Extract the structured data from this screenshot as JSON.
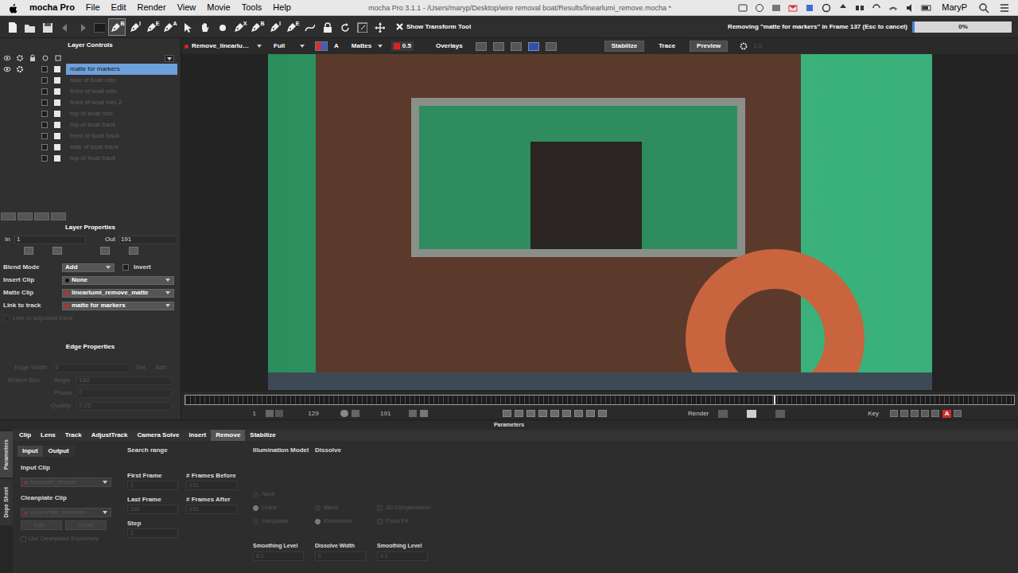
{
  "menubar": {
    "app": "mocha Pro",
    "menus": [
      "File",
      "Edit",
      "Render",
      "View",
      "Movie",
      "Tools",
      "Help"
    ],
    "user": "MaryP"
  },
  "window": {
    "title": "mocha Pro 3.1.1 - /Users/maryp/Desktop/wire removal boat/Results/linearlumi_remove.mocha *"
  },
  "toolbar": {
    "tools": [
      {
        "kind": "new",
        "selected": false
      },
      {
        "kind": "open",
        "selected": false
      },
      {
        "kind": "save",
        "selected": false
      },
      {
        "kind": "back",
        "selected": false
      },
      {
        "kind": "forward",
        "selected": false
      },
      {
        "kind": "box",
        "selected": false
      },
      {
        "kind": "pen",
        "label": "B",
        "selected": true
      },
      {
        "kind": "pen",
        "label": "I",
        "selected": false
      },
      {
        "kind": "pen",
        "label": "E",
        "selected": false
      },
      {
        "kind": "pen",
        "label": "A",
        "selected": false
      },
      {
        "kind": "pointer",
        "selected": false
      },
      {
        "kind": "hand",
        "selected": false
      },
      {
        "kind": "circle",
        "selected": false
      },
      {
        "kind": "pen",
        "label": "X",
        "selected": false
      },
      {
        "kind": "pen",
        "label": "B",
        "selected": false
      },
      {
        "kind": "pen",
        "label": "I",
        "selected": false
      },
      {
        "kind": "pen",
        "label": "E",
        "selected": false
      },
      {
        "kind": "curve",
        "selected": false
      },
      {
        "kind": "lock",
        "selected": false
      },
      {
        "kind": "rotate",
        "selected": false
      },
      {
        "kind": "scale",
        "selected": false
      },
      {
        "kind": "move",
        "selected": false
      }
    ],
    "show_transform": {
      "label": "Show Transform Tool",
      "checked": true
    },
    "status": "Removing \"matte for markers\" in Frame 137 (Esc to cancel)",
    "progress": {
      "reading": "0%",
      "level": 0.0
    }
  },
  "viewerbar": {
    "clip": "Remove_linearlumi_",
    "resolution": "Full",
    "alpha": "A",
    "mattes": "Mattes",
    "opacity": "0.5",
    "overlays": "Overlays",
    "modes": [
      {
        "label": "Stabilize",
        "selected": true
      },
      {
        "label": "Trace",
        "selected": false
      },
      {
        "label": "Preview",
        "selected": true
      }
    ],
    "zoom": "1.0"
  },
  "layer_controls": {
    "title": "Layer Controls",
    "layers": [
      {
        "name": "matte for markers",
        "visible": true,
        "selected": true
      },
      {
        "name": "side of boat roto",
        "visible": false,
        "selected": false
      },
      {
        "name": "front of boat roto",
        "visible": false,
        "selected": false
      },
      {
        "name": "front of boat roto 2",
        "visible": false,
        "selected": false
      },
      {
        "name": "top of boat roto",
        "visible": false,
        "selected": false
      },
      {
        "name": "top of boat track",
        "visible": false,
        "selected": false
      },
      {
        "name": "front of boat track",
        "visible": false,
        "selected": false
      },
      {
        "name": "side of boat track",
        "visible": false,
        "selected": false
      },
      {
        "name": "top of boat track",
        "visible": false,
        "selected": false
      }
    ]
  },
  "layer_properties": {
    "title": "Layer Properties",
    "in_label": "In",
    "in": "1",
    "out_label": "Out",
    "out": "191",
    "blend_mode": {
      "label": "Blend Mode",
      "value": "Add"
    },
    "invert": {
      "label": "Invert",
      "checked": false
    },
    "insert_clip": {
      "label": "Insert Clip",
      "value": "None"
    },
    "matte_clip": {
      "label": "Matte Clip",
      "value": "linearlumi_remove_matte"
    },
    "link_to_track": {
      "label": "Link to track",
      "value": "matte for markers"
    },
    "link_adjusted": {
      "label": "Link to adjusted track",
      "checked": false,
      "disabled": true
    }
  },
  "edge_properties": {
    "title": "Edge Properties",
    "disabled": true,
    "edge_width": {
      "label": "Edge Width",
      "value": "5"
    },
    "set": "Set",
    "add": "Add",
    "motion_blur": "Motion Blur",
    "angle": {
      "label": "Angle",
      "value": "180"
    },
    "phase": {
      "label": "Phase",
      "value": "0"
    },
    "quality": {
      "label": "Quality",
      "value": "0.25"
    }
  },
  "timeline": {
    "playhead": 0.71,
    "start": "1",
    "current": "129",
    "end": "191",
    "render": "Render",
    "key": "Key",
    "auto_key": "A"
  },
  "parameters_label": "Parameters",
  "side_tabs": [
    {
      "label": "Parameters",
      "selected": true
    },
    {
      "label": "Dope Sheet",
      "selected": false
    }
  ],
  "module_tabs": [
    {
      "label": "Clip",
      "selected": false
    },
    {
      "label": "Lens",
      "selected": false
    },
    {
      "label": "Track",
      "selected": false
    },
    {
      "label": "AdjustTrack",
      "selected": false
    },
    {
      "label": "Camera Solve",
      "selected": false
    },
    {
      "label": "Insert",
      "selected": false
    },
    {
      "label": "Remove",
      "selected": true
    },
    {
      "label": "Stabilize",
      "selected": false
    }
  ],
  "remove": {
    "disabled": true,
    "io_tabs": [
      {
        "label": "Input",
        "selected": true
      },
      {
        "label": "Output",
        "selected": false
      }
    ],
    "input_clip": {
      "label": "Input Clip",
      "value": "linearlumi_remove"
    },
    "cleanplate_clip": {
      "label": "Cleanplate Clip",
      "value": "Clean Plate_linearlumi"
    },
    "edit": "Edit...",
    "create": "Create",
    "use_cleanplates": {
      "label": "Use Cleanplates Exclusively",
      "checked": false
    },
    "search_range": {
      "title": "Search range",
      "fields": [
        {
          "label": "First Frame",
          "value": "1"
        },
        {
          "label": "# Frames Before",
          "value": "191"
        },
        {
          "label": "Last Frame",
          "value": "191"
        },
        {
          "label": "# Frames After",
          "value": "191"
        },
        {
          "label": "Step",
          "value": "1"
        }
      ]
    },
    "illumination": {
      "title": "Illumination Model",
      "options": [
        {
          "label": "None",
          "selected": false
        },
        {
          "label": "Linear",
          "selected": true
        },
        {
          "label": "Interpolate",
          "selected": false
        }
      ],
      "smoothing": {
        "label": "Smoothing Level",
        "value": "0.1"
      }
    },
    "blend_options": [
      {
        "label": "Blend",
        "selected": false
      },
      {
        "label": "Randomize",
        "selected": true
      }
    ],
    "extra_options": [
      {
        "label": "3D Compensation",
        "checked": false
      },
      {
        "label": "Flood Fill",
        "checked": false
      }
    ],
    "dissolve": {
      "title": "Dissolve",
      "width": {
        "label": "Dissolve Width",
        "value": "0"
      },
      "smoothing": {
        "label": "Smoothing Level",
        "value": "0.1"
      }
    }
  }
}
